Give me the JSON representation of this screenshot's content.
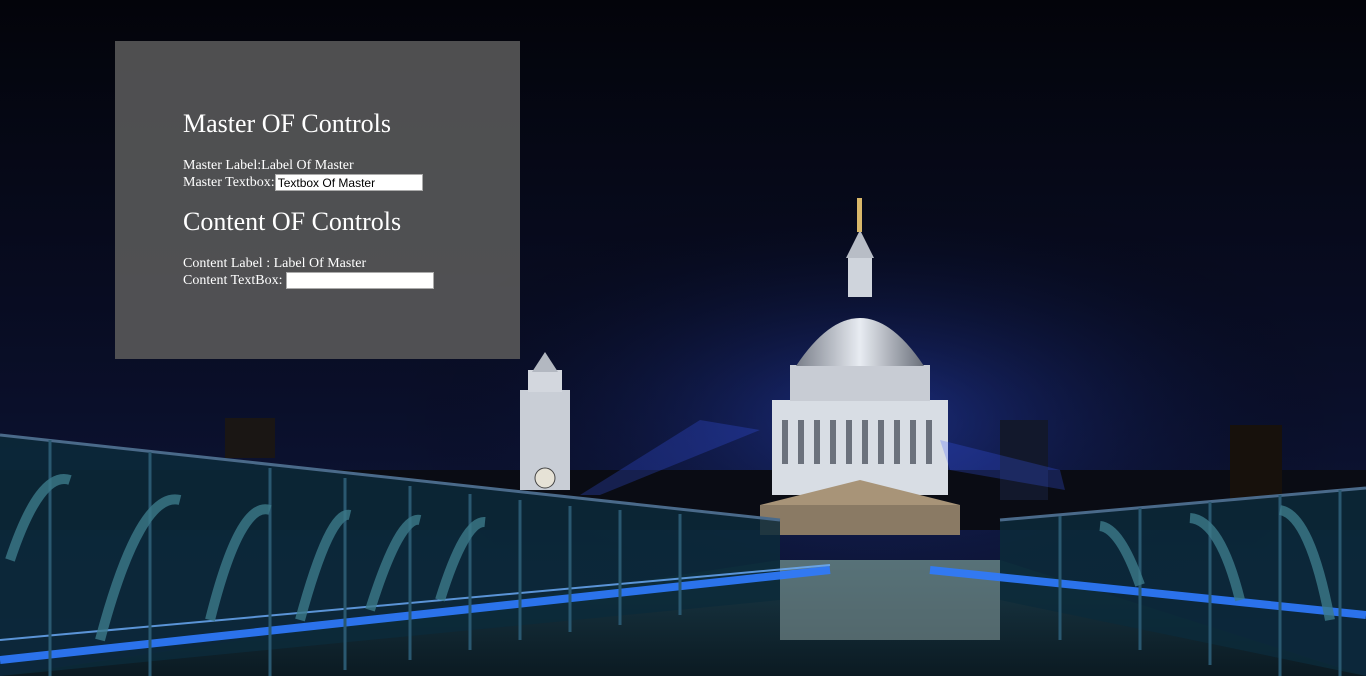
{
  "master": {
    "heading": "Master OF Controls",
    "label_caption": "Master Label:",
    "label_value": "Label Of Master",
    "textbox_caption": "Master Textbox:",
    "textbox_value": "Textbox Of Master"
  },
  "content": {
    "heading": "Content OF Controls",
    "label_caption": "Content Label : ",
    "label_value": "Label Of Master",
    "textbox_caption": "Content TextBox:",
    "textbox_value": ""
  },
  "colors": {
    "panel": "#5a5a5a",
    "sky": "#05070f",
    "bridge_light": "#1f6bff"
  }
}
